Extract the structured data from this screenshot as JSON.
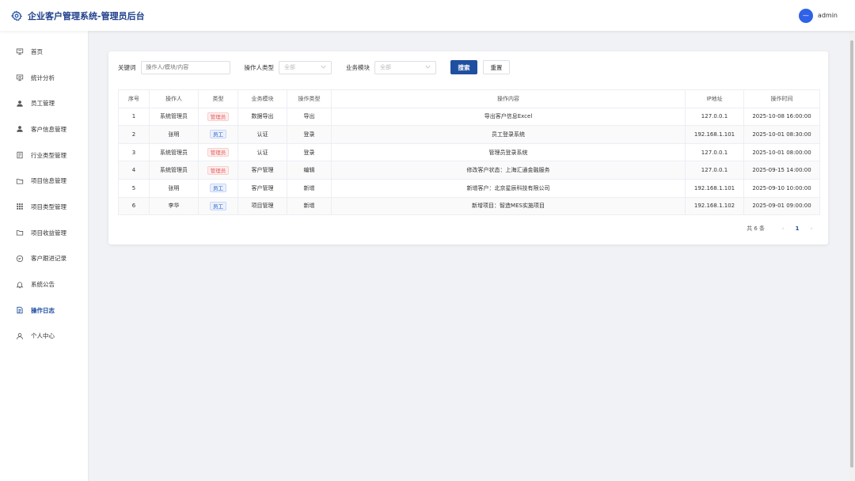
{
  "header": {
    "title": "企业客户管理系统-管理员后台",
    "avatar_text": "—",
    "username": "admin"
  },
  "sidebar": {
    "items": [
      {
        "label": "首页",
        "icon": "home-icon"
      },
      {
        "label": "统计分析",
        "icon": "chart-icon"
      },
      {
        "label": "员工管理",
        "icon": "user-icon"
      },
      {
        "label": "客户信息管理",
        "icon": "user-icon"
      },
      {
        "label": "行业类型管理",
        "icon": "document-icon"
      },
      {
        "label": "项目信息管理",
        "icon": "folder-icon"
      },
      {
        "label": "项目类型管理",
        "icon": "grid-icon"
      },
      {
        "label": "项目收益管理",
        "icon": "folder-icon"
      },
      {
        "label": "客户跟进记录",
        "icon": "chat-icon"
      },
      {
        "label": "系统公告",
        "icon": "bell-icon"
      },
      {
        "label": "操作日志",
        "icon": "log-icon"
      },
      {
        "label": "个人中心",
        "icon": "person-icon"
      }
    ],
    "active": "操作日志"
  },
  "filters": {
    "keyword_label": "关键词",
    "keyword_placeholder": "操作人/模块/内容",
    "type_label": "操作人类型",
    "type_value": "全部",
    "module_label": "业务模块",
    "module_value": "全部",
    "search_label": "搜索",
    "reset_label": "重置"
  },
  "table": {
    "headers": [
      "序号",
      "操作人",
      "类型",
      "业务模块",
      "操作类型",
      "操作内容",
      "IP地址",
      "操作时间"
    ],
    "rows": [
      {
        "no": "1",
        "operator": "系统管理员",
        "type": "管理员",
        "module": "数据导出",
        "action": "导出",
        "content": "导出客户信息Excel",
        "ip": "127.0.0.1",
        "time": "2025-10-08 16:00:00"
      },
      {
        "no": "2",
        "operator": "张明",
        "type": "员工",
        "module": "认证",
        "action": "登录",
        "content": "员工登录系统",
        "ip": "192.168.1.101",
        "time": "2025-10-01 08:30:00"
      },
      {
        "no": "3",
        "operator": "系统管理员",
        "type": "管理员",
        "module": "认证",
        "action": "登录",
        "content": "管理员登录系统",
        "ip": "127.0.0.1",
        "time": "2025-10-01 08:00:00"
      },
      {
        "no": "4",
        "operator": "系统管理员",
        "type": "管理员",
        "module": "客户管理",
        "action": "编辑",
        "content": "修改客户状态：上海汇通金融服务",
        "ip": "127.0.0.1",
        "time": "2025-09-15 14:00:00"
      },
      {
        "no": "5",
        "operator": "张明",
        "type": "员工",
        "module": "客户管理",
        "action": "新增",
        "content": "新增客户：北京星辰科技有限公司",
        "ip": "192.168.1.101",
        "time": "2025-09-10 10:00:00"
      },
      {
        "no": "6",
        "operator": "李华",
        "type": "员工",
        "module": "项目管理",
        "action": "新增",
        "content": "新增项目：智造MES实施项目",
        "ip": "192.168.1.102",
        "time": "2025-09-01 09:00:00"
      }
    ]
  },
  "pagination": {
    "total": "共 6 条",
    "current": "1",
    "prev": "‹",
    "next": "›"
  },
  "colors": {
    "primary": "#1f4fa0",
    "admin_tag": "#e85c5c",
    "staff_tag": "#2a5cc0"
  }
}
